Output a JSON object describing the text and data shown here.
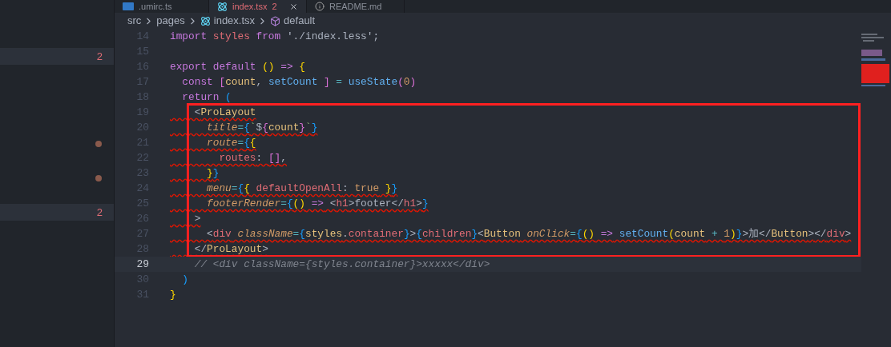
{
  "tabs": [
    {
      "label": ".umirc.ts",
      "kind": "ts",
      "selected": false
    },
    {
      "label": "index.tsx",
      "kind": "react",
      "badge": "2",
      "selected": true
    },
    {
      "label": "README.md",
      "kind": "info",
      "selected": false
    }
  ],
  "breadcrumb": [
    {
      "label": "src",
      "kind": "folder"
    },
    {
      "label": "pages",
      "kind": "folder"
    },
    {
      "label": "index.tsx",
      "kind": "react"
    },
    {
      "label": "default",
      "kind": "symbol"
    }
  ],
  "sidebar": {
    "items": [
      {
        "kind": "badge",
        "text": "2",
        "selected": true
      },
      {
        "kind": "dot",
        "selected": false
      },
      {
        "kind": "dot",
        "selected": false
      },
      {
        "kind": "badge",
        "text": "2",
        "selected": true
      }
    ]
  },
  "editor": {
    "blocks": [
      {
        "boxed": false,
        "lines": [
          {
            "number": "14",
            "error": false,
            "current": false,
            "tokens": [
              {
                "kind": "kw",
                "text": "import"
              },
              {
                "kind": "var",
                "text": " styles "
              },
              {
                "kind": "kw",
                "text": "from"
              },
              {
                "kind": "plain",
                "text": " './index.less';"
              }
            ]
          },
          {
            "number": "15",
            "error": false,
            "current": false
          },
          {
            "number": "16",
            "error": false,
            "current": false,
            "tokens": [
              {
                "kind": "kw",
                "text": "export default"
              },
              {
                "kind": "b1",
                "text": " ()"
              },
              {
                "kind": "kw",
                "text": " =>"
              },
              {
                "kind": "b1",
                "text": " {"
              }
            ]
          },
          {
            "number": "17",
            "error": false,
            "current": false,
            "tokens": [
              {
                "kind": "kw",
                "text": "  const"
              },
              {
                "kind": "b2",
                "text": " ["
              },
              {
                "kind": "comp",
                "text": "count"
              },
              {
                "kind": "plain",
                "text": ", "
              },
              {
                "kind": "fn",
                "text": "setCount"
              },
              {
                "kind": "b2",
                "text": " ]"
              },
              {
                "kind": "op",
                "text": " = "
              },
              {
                "kind": "fn",
                "text": "useState"
              },
              {
                "kind": "b2",
                "text": "("
              },
              {
                "kind": "num",
                "text": "0"
              },
              {
                "kind": "b2",
                "text": ")"
              }
            ]
          },
          {
            "number": "18",
            "error": false,
            "current": false,
            "tokens": [
              {
                "kind": "kw",
                "text": "  return"
              },
              {
                "kind": "b3",
                "text": " ("
              }
            ]
          }
        ]
      },
      {
        "boxed": true,
        "lines": [
          {
            "number": "19",
            "error": true,
            "current": false,
            "tokens": [
              {
                "kind": "plain",
                "text": "    <"
              },
              {
                "kind": "comp",
                "text": "ProLayout"
              }
            ]
          },
          {
            "number": "20",
            "error": true,
            "current": false,
            "tokens": [
              {
                "kind": "attr",
                "text": "      title"
              },
              {
                "kind": "op",
                "text": "="
              },
              {
                "kind": "b3",
                "text": "{"
              },
              {
                "kind": "str",
                "text": "`"
              },
              {
                "kind": "plain",
                "text": "$"
              },
              {
                "kind": "b2",
                "text": "{"
              },
              {
                "kind": "comp",
                "text": "count"
              },
              {
                "kind": "b2",
                "text": "}"
              },
              {
                "kind": "str",
                "text": "`"
              },
              {
                "kind": "b3",
                "text": "}"
              }
            ]
          },
          {
            "number": "21",
            "error": true,
            "current": false,
            "tokens": [
              {
                "kind": "attr",
                "text": "      route"
              },
              {
                "kind": "op",
                "text": "="
              },
              {
                "kind": "b3",
                "text": "{"
              },
              {
                "kind": "b1",
                "text": "{"
              }
            ]
          },
          {
            "number": "22",
            "error": true,
            "current": false,
            "tokens": [
              {
                "kind": "var",
                "text": "        routes"
              },
              {
                "kind": "plain",
                "text": ": "
              },
              {
                "kind": "b2",
                "text": "[]"
              },
              {
                "kind": "plain",
                "text": ","
              }
            ]
          },
          {
            "number": "23",
            "error": true,
            "current": false,
            "tokens": [
              {
                "kind": "b1",
                "text": "      }"
              },
              {
                "kind": "b3",
                "text": "}"
              }
            ]
          },
          {
            "number": "24",
            "error": true,
            "current": false,
            "tokens": [
              {
                "kind": "attr",
                "text": "      menu"
              },
              {
                "kind": "op",
                "text": "="
              },
              {
                "kind": "b3",
                "text": "{"
              },
              {
                "kind": "b1",
                "text": "{"
              },
              {
                "kind": "var",
                "text": " defaultOpenAll"
              },
              {
                "kind": "plain",
                "text": ": "
              },
              {
                "kind": "num",
                "text": "true"
              },
              {
                "kind": "b1",
                "text": " }"
              },
              {
                "kind": "b3",
                "text": "}"
              }
            ]
          },
          {
            "number": "25",
            "error": true,
            "current": false,
            "tokens": [
              {
                "kind": "attr",
                "text": "      footerRender"
              },
              {
                "kind": "op",
                "text": "="
              },
              {
                "kind": "b3",
                "text": "{"
              },
              {
                "kind": "b1",
                "text": "()"
              },
              {
                "kind": "kw",
                "text": " =>"
              },
              {
                "kind": "plain",
                "text": " <"
              },
              {
                "kind": "var",
                "text": "h1"
              },
              {
                "kind": "plain",
                "text": ">footer</"
              },
              {
                "kind": "var",
                "text": "h1"
              },
              {
                "kind": "plain",
                "text": ">"
              },
              {
                "kind": "b3",
                "text": "}"
              }
            ]
          },
          {
            "number": "26",
            "error": true,
            "current": false,
            "tokens": [
              {
                "kind": "plain",
                "text": "    >"
              }
            ]
          },
          {
            "number": "27",
            "error": true,
            "current": false,
            "tokens": [
              {
                "kind": "plain",
                "text": "      <"
              },
              {
                "kind": "var",
                "text": "div"
              },
              {
                "kind": "attr",
                "text": " className"
              },
              {
                "kind": "op",
                "text": "="
              },
              {
                "kind": "b3",
                "text": "{"
              },
              {
                "kind": "comp",
                "text": "styles"
              },
              {
                "kind": "plain",
                "text": "."
              },
              {
                "kind": "var",
                "text": "container"
              },
              {
                "kind": "b3",
                "text": "}"
              },
              {
                "kind": "plain",
                "text": ">"
              },
              {
                "kind": "b3",
                "text": "{"
              },
              {
                "kind": "var",
                "text": "children"
              },
              {
                "kind": "b3",
                "text": "}"
              },
              {
                "kind": "plain",
                "text": "<"
              },
              {
                "kind": "comp",
                "text": "Button"
              },
              {
                "kind": "attr",
                "text": " onClick"
              },
              {
                "kind": "op",
                "text": "="
              },
              {
                "kind": "b3",
                "text": "{"
              },
              {
                "kind": "b1",
                "text": "()"
              },
              {
                "kind": "kw",
                "text": " =>"
              },
              {
                "kind": "fn",
                "text": " setCount"
              },
              {
                "kind": "b1",
                "text": "("
              },
              {
                "kind": "comp",
                "text": "count"
              },
              {
                "kind": "op",
                "text": " + "
              },
              {
                "kind": "num",
                "text": "1"
              },
              {
                "kind": "b1",
                "text": ")"
              },
              {
                "kind": "b3",
                "text": "}"
              },
              {
                "kind": "plain",
                "text": ">加</"
              },
              {
                "kind": "comp",
                "text": "Button"
              },
              {
                "kind": "plain",
                "text": "></"
              },
              {
                "kind": "var",
                "text": "div"
              },
              {
                "kind": "plain",
                "text": ">"
              }
            ]
          },
          {
            "number": "28",
            "error": true,
            "current": false,
            "tokens": [
              {
                "kind": "plain",
                "text": "    </"
              },
              {
                "kind": "comp",
                "text": "ProLayout"
              },
              {
                "kind": "plain",
                "text": ">"
              }
            ]
          }
        ]
      },
      {
        "boxed": false,
        "lines": [
          {
            "number": "29",
            "error": false,
            "current": true,
            "tokens": [
              {
                "kind": "comment",
                "text": "    // <div className={styles.container}>xxxxx</div>"
              }
            ]
          },
          {
            "number": "30",
            "error": false,
            "current": false,
            "tokens": [
              {
                "kind": "b3",
                "text": "  )"
              }
            ]
          },
          {
            "number": "31",
            "error": false,
            "current": false,
            "tokens": [
              {
                "kind": "b1",
                "text": "}"
              }
            ]
          }
        ]
      }
    ]
  }
}
